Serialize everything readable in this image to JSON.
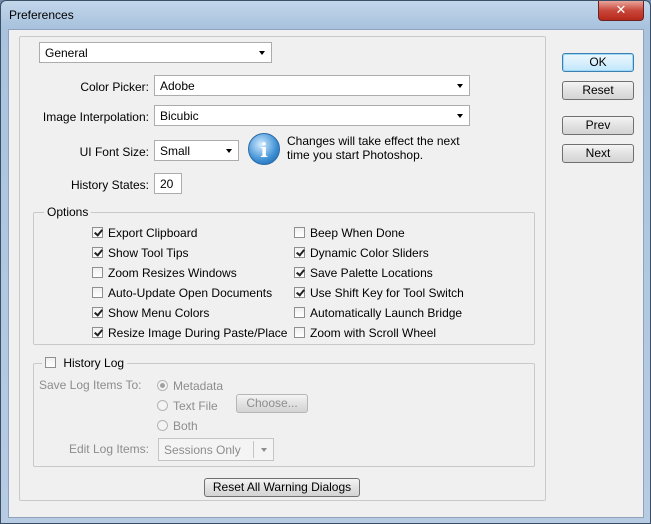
{
  "window": {
    "title": "Preferences",
    "close_glyph": "✕"
  },
  "category": {
    "selected": "General"
  },
  "fields": {
    "color_picker": {
      "label": "Color Picker:",
      "value": "Adobe"
    },
    "interpolation": {
      "label": "Image Interpolation:",
      "value": "Bicubic"
    },
    "ui_font_size": {
      "label": "UI Font Size:",
      "value": "Small"
    },
    "history_states": {
      "label": "History States:",
      "value": "20"
    }
  },
  "notice": {
    "icon": "info-icon",
    "glyph": "i",
    "line1": "Changes will take effect the next",
    "line2": "time you start Photoshop."
  },
  "buttons": {
    "ok": "OK",
    "reset": "Reset",
    "prev": "Prev",
    "next": "Next",
    "reset_warnings": "Reset All Warning Dialogs"
  },
  "options": {
    "title": "Options",
    "left": [
      {
        "label": "Export Clipboard",
        "checked": true
      },
      {
        "label": "Show Tool Tips",
        "checked": true
      },
      {
        "label": "Zoom Resizes Windows",
        "checked": false
      },
      {
        "label": "Auto-Update Open Documents",
        "checked": false
      },
      {
        "label": "Show Menu Colors",
        "checked": true
      },
      {
        "label": "Resize Image During Paste/Place",
        "checked": true
      }
    ],
    "right": [
      {
        "label": "Beep When Done",
        "checked": false
      },
      {
        "label": "Dynamic Color Sliders",
        "checked": true
      },
      {
        "label": "Save Palette Locations",
        "checked": true
      },
      {
        "label": "Use Shift Key for Tool Switch",
        "checked": true
      },
      {
        "label": "Automatically Launch Bridge",
        "checked": false
      },
      {
        "label": "Zoom with Scroll Wheel",
        "checked": false
      }
    ]
  },
  "history_log": {
    "title": "History Log",
    "enabled": false,
    "save_to_label": "Save Log Items To:",
    "radios": [
      {
        "label": "Metadata",
        "selected": true
      },
      {
        "label": "Text File",
        "selected": false
      },
      {
        "label": "Both",
        "selected": false
      }
    ],
    "choose_label": "Choose...",
    "edit_label": "Edit Log Items:",
    "edit_value": "Sessions Only"
  },
  "colors": {
    "accent": "#3c7fb1",
    "title_bar": "#b7cce3",
    "close": "#c8473a",
    "disabled_text": "#8d8d8d"
  }
}
